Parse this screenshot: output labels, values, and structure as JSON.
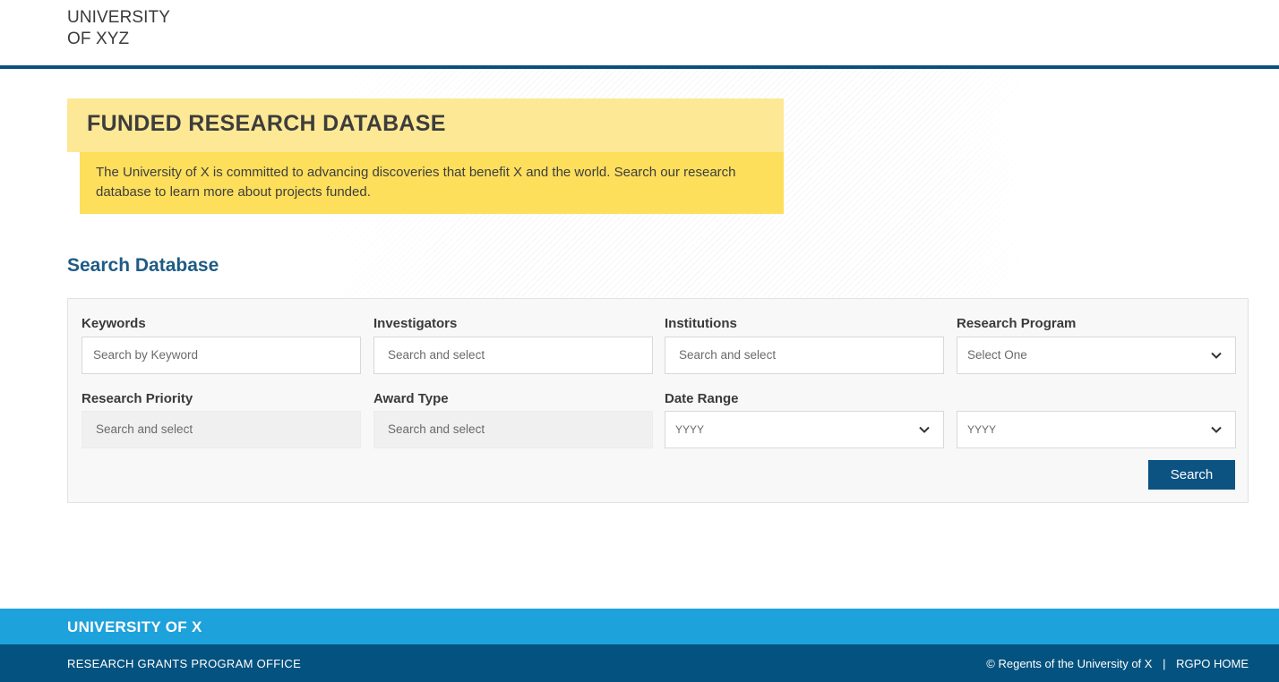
{
  "header": {
    "logo_line1": "UNIVERSITY",
    "logo_line2": "OF XYZ"
  },
  "hero": {
    "title": "FUNDED RESEARCH DATABASE",
    "description": "The University of X is committed to advancing discoveries that benefit X and the world. Search our research database to learn more about projects funded."
  },
  "search": {
    "section_title": "Search Database",
    "fields": {
      "keywords": {
        "label": "Keywords",
        "placeholder": "Search by Keyword"
      },
      "investigators": {
        "label": "Investigators",
        "placeholder": "Search and select"
      },
      "institutions": {
        "label": "Institutions",
        "placeholder": "Search and select"
      },
      "research_program": {
        "label": "Research Program",
        "value": "Select One"
      },
      "research_priority": {
        "label": "Research Priority",
        "placeholder": "Search and select"
      },
      "award_type": {
        "label": "Award Type",
        "placeholder": "Search and select"
      },
      "date_range": {
        "label": "Date Range",
        "from": "YYYY",
        "to": "YYYY"
      }
    },
    "search_button": "Search"
  },
  "footer": {
    "brand": "UNIVERSITY OF X",
    "office": "RESEARCH GRANTS PROGRAM OFFICE",
    "copyright": "© Regents of the University of X",
    "separator": "|",
    "home_link": "RGPO HOME"
  },
  "colors": {
    "header_rule": "#0c4f7d",
    "hero_title_bg": "#fde995",
    "hero_desc_bg": "#fddf5c",
    "section_title": "#1e5b86",
    "button_bg": "#0c5382",
    "footer_top": "#1ea2dc",
    "footer_bottom": "#04527f"
  }
}
